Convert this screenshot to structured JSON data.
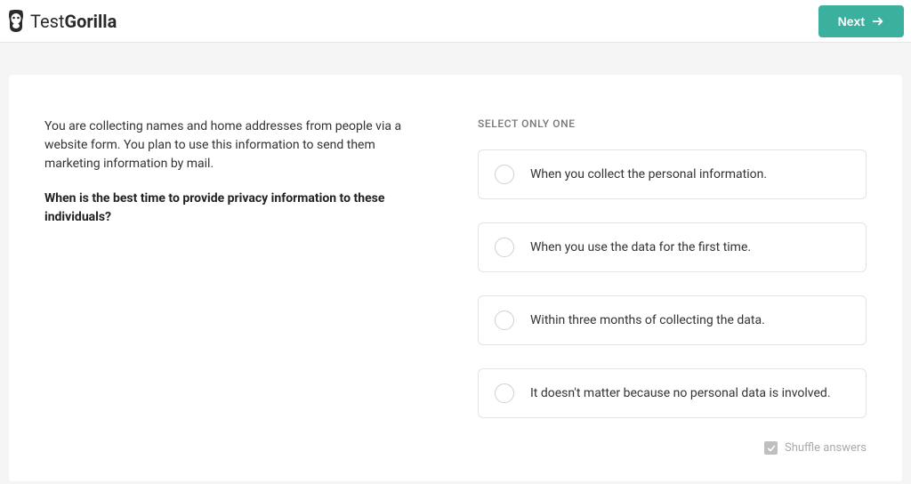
{
  "header": {
    "logo_text_a": "Test",
    "logo_text_b": "Gorilla",
    "next_label": "Next"
  },
  "question": {
    "context": "You are collecting names and home addresses from people via a website form.  You plan to use this information to send them marketing information by mail.",
    "prompt": "When is the best time to provide privacy information to these individuals?"
  },
  "answers": {
    "instruction": "SELECT ONLY ONE",
    "options": [
      "When you collect the personal information.",
      "When you use the data for the first time.",
      "Within three months of collecting the data.",
      "It doesn't matter because no personal data is involved."
    ],
    "shuffle_label": "Shuffle answers"
  }
}
